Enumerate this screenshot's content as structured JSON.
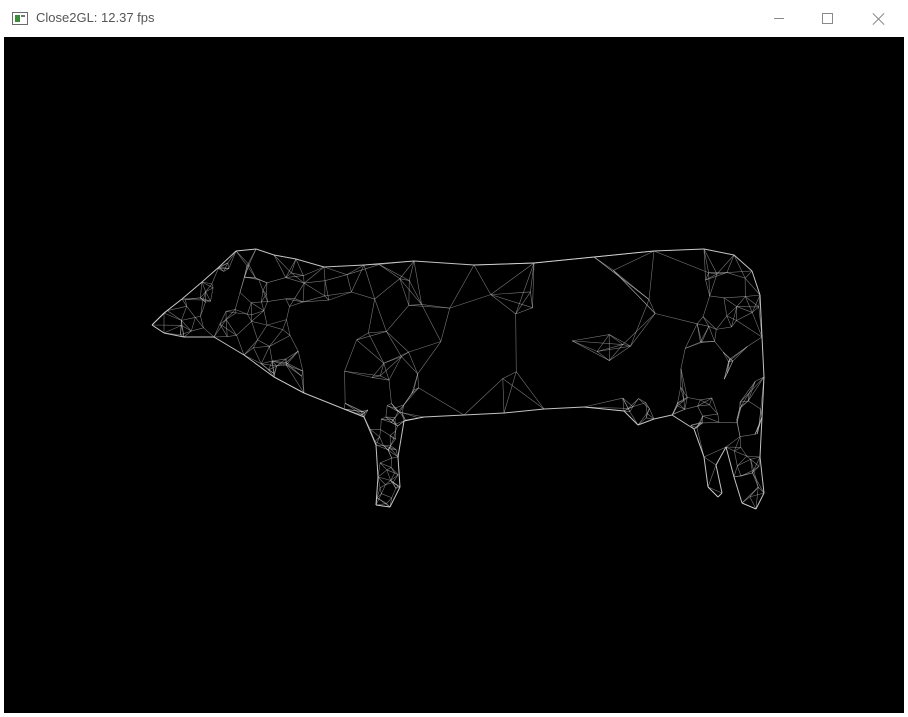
{
  "window": {
    "title": "Close2GL: 12.37 fps",
    "controls": {
      "minimize": "minimize-icon",
      "maximize": "maximize-icon",
      "close": "close-icon"
    }
  },
  "viewport": {
    "background": "#000000",
    "wire_color": "#d8d8d8",
    "model": "cow"
  }
}
